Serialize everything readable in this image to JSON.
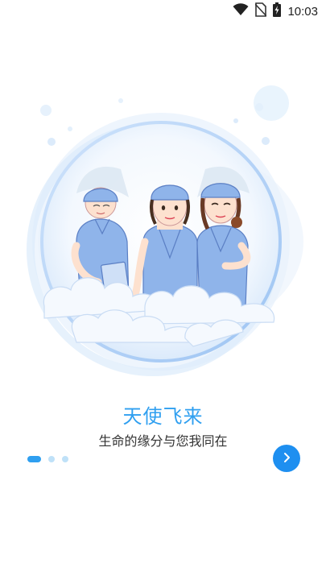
{
  "status_bar": {
    "time": "10:03",
    "icons": [
      "wifi-icon",
      "no-sim-icon",
      "battery-charging-icon"
    ]
  },
  "onboarding": {
    "title": "天使飞来",
    "subtitle": "生命的缘分与您我同在",
    "page_indicator": {
      "current": 1,
      "total": 3
    },
    "next_button_icon": "chevron-right-icon",
    "colors": {
      "accent": "#2f9ff0",
      "button": "#1e8ff0",
      "dot_inactive": "#bfe1f8"
    }
  }
}
